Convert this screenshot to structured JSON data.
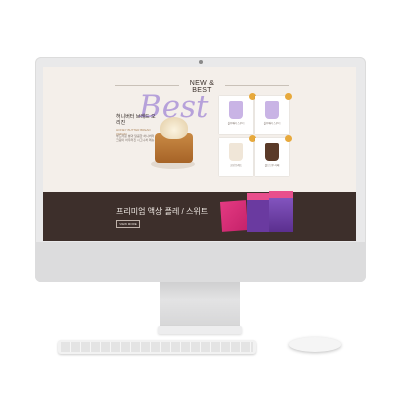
{
  "site": {
    "section_title": "NEW & BEST",
    "best_word": "Best",
    "product_name": "허니버터 브레드 오리진",
    "product_sub": "HONEY BUTTER BREAD ORIGIN",
    "product_desc": "부드러운 빵과 달콤한 허니버터 크림이 어우러진 시그니처 메뉴",
    "cards": [
      {
        "label": "블루베리 스무디",
        "cup_color": "#c9b4e5"
      },
      {
        "label": "블루베리 스무디",
        "cup_color": "#c9b4e5"
      },
      {
        "label": "크림 브레드",
        "cup_color": "#f0e6d8"
      },
      {
        "label": "콜드브루 라떼",
        "cup_color": "#5a3a28"
      }
    ],
    "banner_text": "프리미엄 액상 플레 / 스위트",
    "banner_button": "VIEW MORE",
    "accent_purple": "#b6a1da",
    "banner_bg": "#3d2f2b"
  }
}
